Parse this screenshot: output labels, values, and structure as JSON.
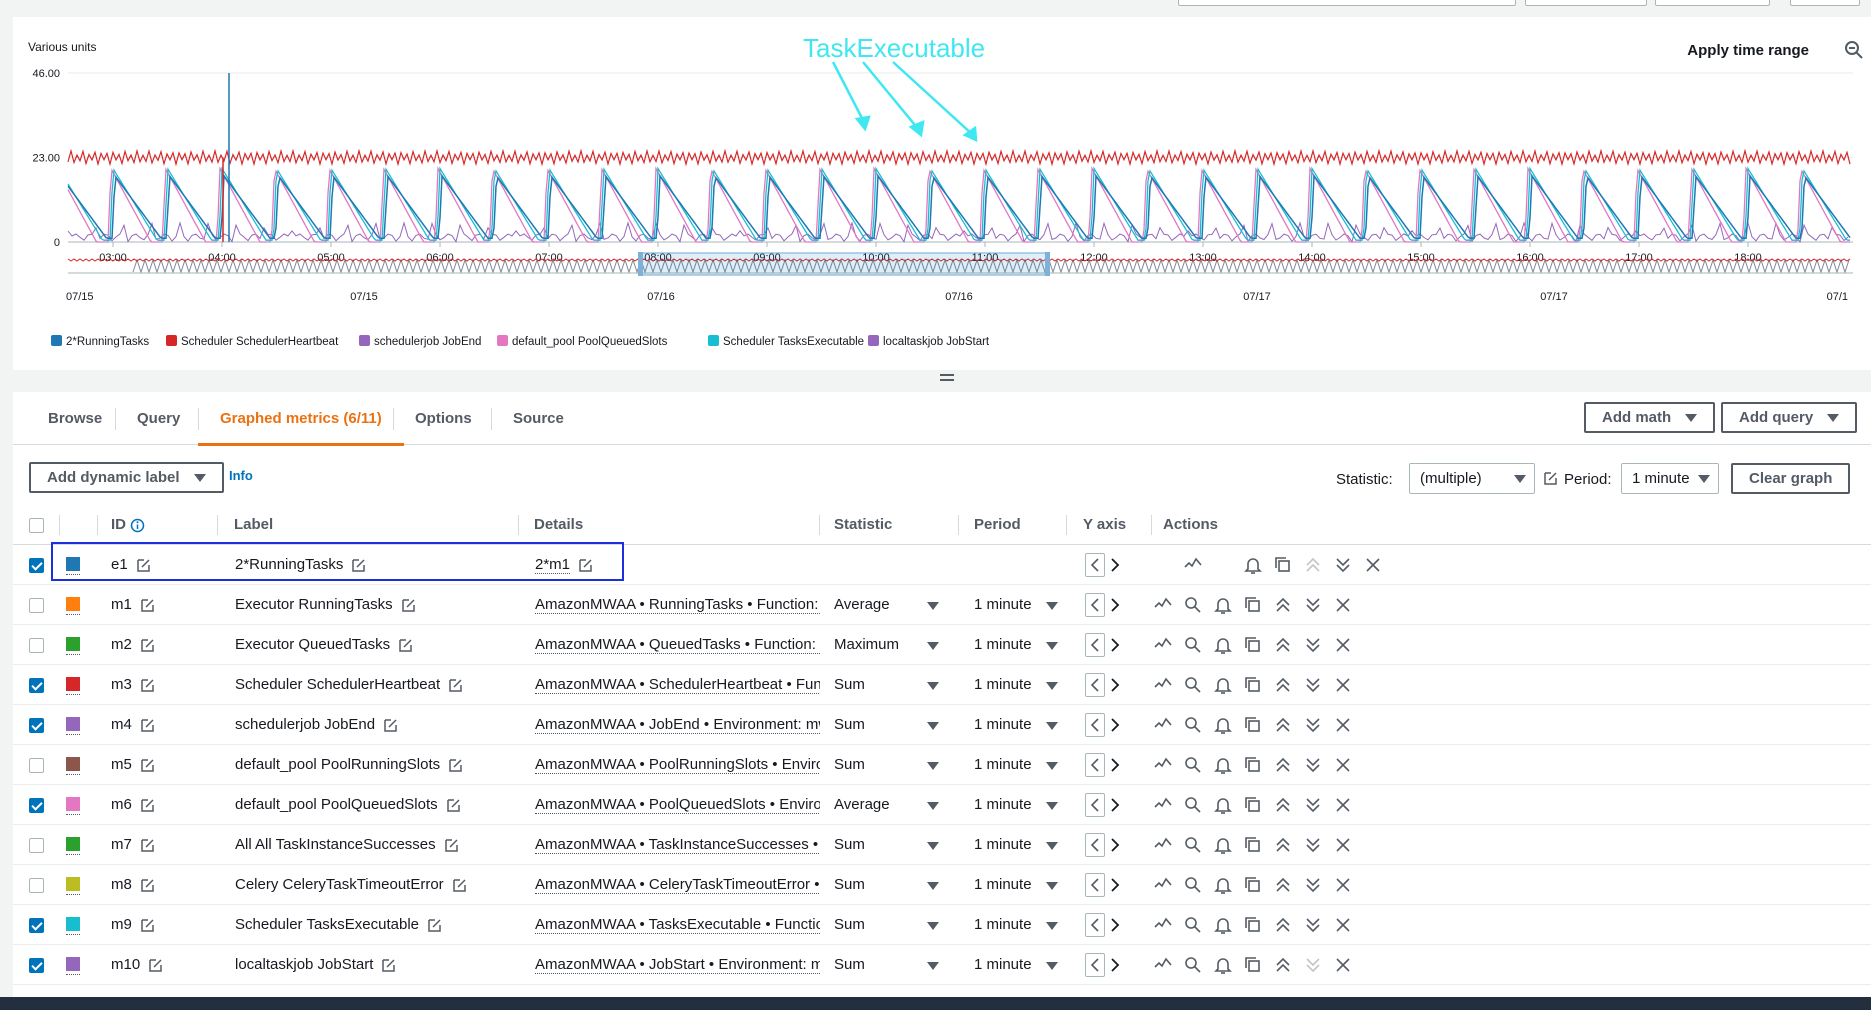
{
  "chart": {
    "y_unit_label": "Various units",
    "apply_time_range_label": "Apply time range",
    "annotation": "TaskExecutable",
    "y_ticks": [
      "46.00",
      "23.00",
      "0"
    ],
    "x_ticks": [
      "03:00",
      "04:00",
      "05:00",
      "06:00",
      "07:00",
      "08:00",
      "09:00",
      "10:00",
      "11:00",
      "12:00",
      "13:00",
      "14:00",
      "15:00",
      "16:00",
      "17:00",
      "18:00"
    ],
    "overview_ticks": [
      "07/15",
      "07/15",
      "07/16",
      "07/16",
      "07/17",
      "07/17",
      "07/1"
    ],
    "legend": [
      {
        "label": "2*RunningTasks",
        "color": "#1f77b4"
      },
      {
        "label": "Scheduler SchedulerHeartbeat",
        "color": "#d62728"
      },
      {
        "label": "schedulerjob JobEnd",
        "color": "#9467bd"
      },
      {
        "label": "default_pool PoolQueuedSlots",
        "color": "#e377c2"
      },
      {
        "label": "Scheduler TasksExecutable",
        "color": "#17becf"
      },
      {
        "label": "localtaskjob JobStart",
        "color": "#9467bd"
      }
    ]
  },
  "chart_data": {
    "type": "line",
    "ylabel": "Various units",
    "ylim": [
      0,
      46
    ],
    "x": [
      "03:00",
      "04:00",
      "05:00",
      "06:00",
      "07:00",
      "08:00",
      "09:00",
      "10:00",
      "11:00",
      "12:00",
      "13:00",
      "14:00",
      "15:00",
      "16:00",
      "17:00",
      "18:00"
    ],
    "series": [
      {
        "name": "2*RunningTasks",
        "color": "#1f77b4",
        "peak_value": 46,
        "typical_peak": 18,
        "period_minutes": 30
      },
      {
        "name": "Scheduler SchedulerHeartbeat",
        "color": "#d62728",
        "typical_value": 23
      },
      {
        "name": "schedulerjob JobEnd",
        "color": "#9467bd",
        "typical_value": 2
      },
      {
        "name": "default_pool PoolQueuedSlots",
        "color": "#e377c2",
        "typical_peak": 20,
        "period_minutes": 30
      },
      {
        "name": "Scheduler TasksExecutable",
        "color": "#17becf",
        "typical_peak": 20,
        "period_minutes": 30
      },
      {
        "name": "localtaskjob JobStart",
        "color": "#9467bd",
        "typical_value": 2
      }
    ],
    "legend_position": "bottom"
  },
  "tabs": [
    {
      "label": "Browse"
    },
    {
      "label": "Query"
    },
    {
      "label": "Graphed metrics (6/11)"
    },
    {
      "label": "Options"
    },
    {
      "label": "Source"
    }
  ],
  "toolbar": {
    "add_math": "Add math",
    "add_query": "Add query",
    "add_dynamic_label": "Add dynamic label",
    "info": "Info",
    "statistic_label": "Statistic:",
    "statistic_value": "(multiple)",
    "period_label": "Period:",
    "period_value": "1 minute",
    "clear_graph": "Clear graph"
  },
  "columns": {
    "id": "ID",
    "label": "Label",
    "details": "Details",
    "statistic": "Statistic",
    "period": "Period",
    "yaxis": "Y axis",
    "actions": "Actions"
  },
  "rows": [
    {
      "id": "e1",
      "label": "2*RunningTasks",
      "details": "2*m1",
      "statistic": "",
      "period": "",
      "checked": true,
      "color": "#1f77b4"
    },
    {
      "id": "m1",
      "label": "Executor RunningTasks",
      "details": "AmazonMWAA • RunningTasks • Function: Exe",
      "statistic": "Average",
      "period": "1 minute",
      "checked": false,
      "color": "#ff7f0e"
    },
    {
      "id": "m2",
      "label": "Executor QueuedTasks",
      "details": "AmazonMWAA • QueuedTasks • Function: Exe",
      "statistic": "Maximum",
      "period": "1 minute",
      "checked": false,
      "color": "#2ca02c"
    },
    {
      "id": "m3",
      "label": "Scheduler SchedulerHeartbeat",
      "details": "AmazonMWAA • SchedulerHeartbeat • Functi",
      "statistic": "Sum",
      "period": "1 minute",
      "checked": true,
      "color": "#d62728"
    },
    {
      "id": "m4",
      "label": "schedulerjob JobEnd",
      "details": "AmazonMWAA • JobEnd • Environment: mwa",
      "statistic": "Sum",
      "period": "1 minute",
      "checked": true,
      "color": "#9467bd"
    },
    {
      "id": "m5",
      "label": "default_pool PoolRunningSlots",
      "details": "AmazonMWAA • PoolRunningSlots • Environm",
      "statistic": "Sum",
      "period": "1 minute",
      "checked": false,
      "color": "#8c564b"
    },
    {
      "id": "m6",
      "label": "default_pool PoolQueuedSlots",
      "details": "AmazonMWAA • PoolQueuedSlots • Environm",
      "statistic": "Average",
      "period": "1 minute",
      "checked": true,
      "color": "#e377c2"
    },
    {
      "id": "m7",
      "label": "All All TaskInstanceSuccesses",
      "details": "AmazonMWAA • TaskInstanceSuccesses • Task",
      "statistic": "Sum",
      "period": "1 minute",
      "checked": false,
      "color": "#2ca02c"
    },
    {
      "id": "m8",
      "label": "Celery CeleryTaskTimeoutError",
      "details": "AmazonMWAA • CeleryTaskTimeoutError • Fu",
      "statistic": "Sum",
      "period": "1 minute",
      "checked": false,
      "color": "#bcbd22"
    },
    {
      "id": "m9",
      "label": "Scheduler TasksExecutable",
      "details": "AmazonMWAA • TasksExecutable • Function:",
      "statistic": "Sum",
      "period": "1 minute",
      "checked": true,
      "color": "#17becf"
    },
    {
      "id": "m10",
      "label": "localtaskjob JobStart",
      "details": "AmazonMWAA • JobStart • Environment: mw",
      "statistic": "Sum",
      "period": "1 minute",
      "checked": true,
      "color": "#9467bd"
    }
  ]
}
